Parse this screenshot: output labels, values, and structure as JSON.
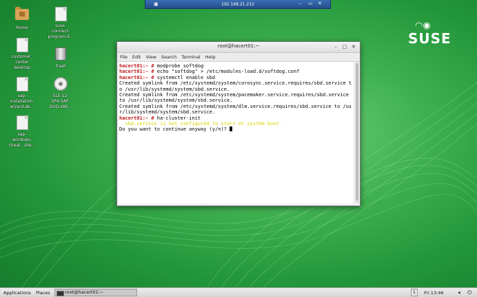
{
  "remote_bar": {
    "address": "192.168.21.212"
  },
  "desktop_icons": [
    {
      "label": "Home",
      "icon": "folder-home-icon"
    },
    {
      "label": "suse-\nconnect-\nprogram.d...",
      "icon": "document-icon"
    },
    {
      "label": "customer_\ncenter\ndesktop",
      "icon": "document-icon"
    },
    {
      "label": "Trash",
      "icon": "trash-icon"
    },
    {
      "label": "sap-\ninstallation-\nwizard.de...",
      "icon": "document-icon"
    },
    {
      "label": "SLE-12-\nSP4-SAP-\nDVD-x86...",
      "icon": "disc-icon"
    },
    {
      "label": "sap-\nwindows-\ncheat...she...",
      "icon": "document-icon"
    }
  ],
  "logo": {
    "text": "SUSE"
  },
  "terminal": {
    "title": "root@hacert01:~",
    "menu": [
      "File",
      "Edit",
      "View",
      "Search",
      "Terminal",
      "Help"
    ],
    "prompt": "hacert01:~ #",
    "lines": [
      {
        "type": "cmd",
        "text": " modprobe softdog"
      },
      {
        "type": "cmd",
        "text": " echo \"softdog\" > /etc/modules-load.d/softdog.conf"
      },
      {
        "type": "cmd",
        "text": " systemctl enable sbd"
      },
      {
        "type": "out",
        "text": "Created symlink from /etc/systemd/system/corosync.service.requires/sbd.service t"
      },
      {
        "type": "out",
        "text": "o /usr/lib/systemd/system/sbd.service."
      },
      {
        "type": "out",
        "text": "Created symlink from /etc/systemd/system/pacemaker.service.requires/sbd.service"
      },
      {
        "type": "out",
        "text": "to /usr/lib/systemd/system/sbd.service."
      },
      {
        "type": "out",
        "text": "Created symlink from /etc/systemd/system/dlm.service.requires/sbd.service to /us"
      },
      {
        "type": "out",
        "text": "r/lib/systemd/system/sbd.service."
      },
      {
        "type": "cmd",
        "text": " ha-cluster-init"
      },
      {
        "type": "warn",
        "text": "  sbd.service is not configured to start at system boot."
      },
      {
        "type": "out",
        "text": "Do you want to continue anyway (y/n)? "
      }
    ]
  },
  "taskbar": {
    "applications": "Applications",
    "places": "Places",
    "task": "root@hacert01:~",
    "workspace": "1",
    "clock": "Fri 13:46"
  },
  "colors": {
    "prompt": "#c01818",
    "warning": "#d8d100",
    "desktop": "#23963a"
  }
}
